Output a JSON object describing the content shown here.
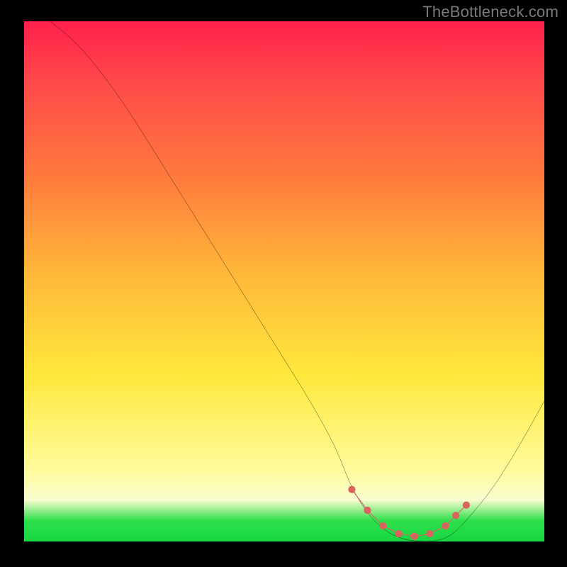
{
  "watermark": "TheBottleneck.com",
  "chart_data": {
    "type": "line",
    "title": "",
    "xlabel": "",
    "ylabel": "",
    "xlim": [
      0,
      100
    ],
    "ylim": [
      0,
      100
    ],
    "series": [
      {
        "name": "bottleneck-curve",
        "x": [
          5,
          10,
          15,
          20,
          25,
          30,
          35,
          40,
          45,
          50,
          55,
          60,
          63,
          67,
          71,
          75,
          79,
          82,
          85,
          90,
          95,
          100
        ],
        "values": [
          100,
          96,
          90,
          83,
          75,
          67,
          59,
          51,
          43,
          35,
          27,
          18,
          10,
          4,
          1,
          0,
          0,
          1,
          4,
          10,
          18,
          27
        ]
      }
    ],
    "markers": {
      "name": "highlight-band",
      "color": "#d9645f",
      "points": [
        {
          "x": 63,
          "y": 10
        },
        {
          "x": 66,
          "y": 6
        },
        {
          "x": 69,
          "y": 3
        },
        {
          "x": 72,
          "y": 1.5
        },
        {
          "x": 75,
          "y": 1
        },
        {
          "x": 78,
          "y": 1.5
        },
        {
          "x": 81,
          "y": 3
        },
        {
          "x": 83,
          "y": 5
        },
        {
          "x": 85,
          "y": 7
        }
      ]
    },
    "gradient_stops": [
      {
        "pos": 0.0,
        "color": "#ff1f4b"
      },
      {
        "pos": 0.12,
        "color": "#ff4a4a"
      },
      {
        "pos": 0.3,
        "color": "#ff7a3d"
      },
      {
        "pos": 0.48,
        "color": "#ffb63a"
      },
      {
        "pos": 0.68,
        "color": "#ffe83c"
      },
      {
        "pos": 0.86,
        "color": "#fffb9a"
      },
      {
        "pos": 0.92,
        "color": "#f9fccf"
      },
      {
        "pos": 0.96,
        "color": "#2ee04b"
      },
      {
        "pos": 1.0,
        "color": "#17d643"
      }
    ]
  }
}
